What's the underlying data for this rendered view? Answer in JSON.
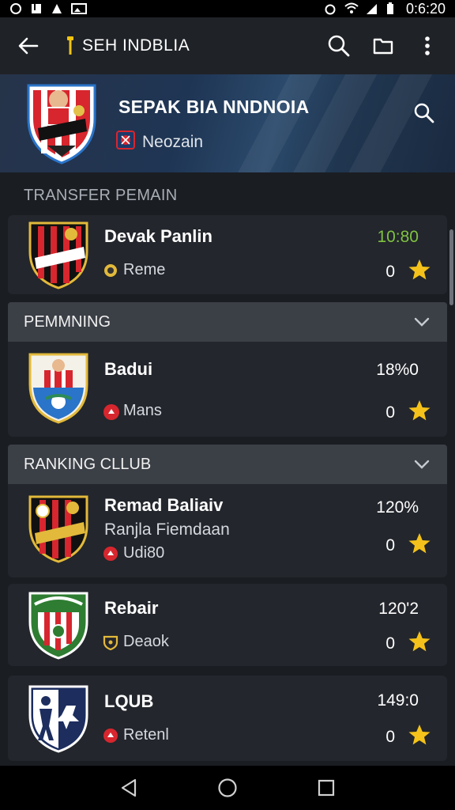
{
  "status_bar": {
    "time": "0:6:20"
  },
  "app_bar": {
    "title": "SEH INDBLIA"
  },
  "hero": {
    "title": "SEPAK BIA NNDNOIA",
    "subtitle": "Neozain"
  },
  "sections": {
    "transfer": "TRANSFER PEMAIN",
    "pemmning": "PEMMNING",
    "ranking": "RANKING CLLUB"
  },
  "cards": [
    {
      "name": "Devak Panlin",
      "meta": "Reme",
      "value": "10:80",
      "count": "0",
      "value_color": "#7fc241"
    },
    {
      "name": "Badui",
      "meta": "Mans",
      "value": "18%0",
      "count": "0",
      "value_color": "#ffffff"
    },
    {
      "name": "Remad Baliaiv",
      "sub": "Ranjla Fiemdaan",
      "meta": "Udi80",
      "value": "120%",
      "count": "0",
      "value_color": "#ffffff"
    },
    {
      "name": "Rebair",
      "meta": "Deaok",
      "value": "120'2",
      "count": "0",
      "value_color": "#ffffff"
    },
    {
      "name": "LQUB",
      "meta": "Retenl",
      "value": "149:0",
      "count": "0",
      "value_color": "#ffffff"
    }
  ],
  "colors": {
    "star": "#f4c21a",
    "accent_green": "#7fc241"
  }
}
